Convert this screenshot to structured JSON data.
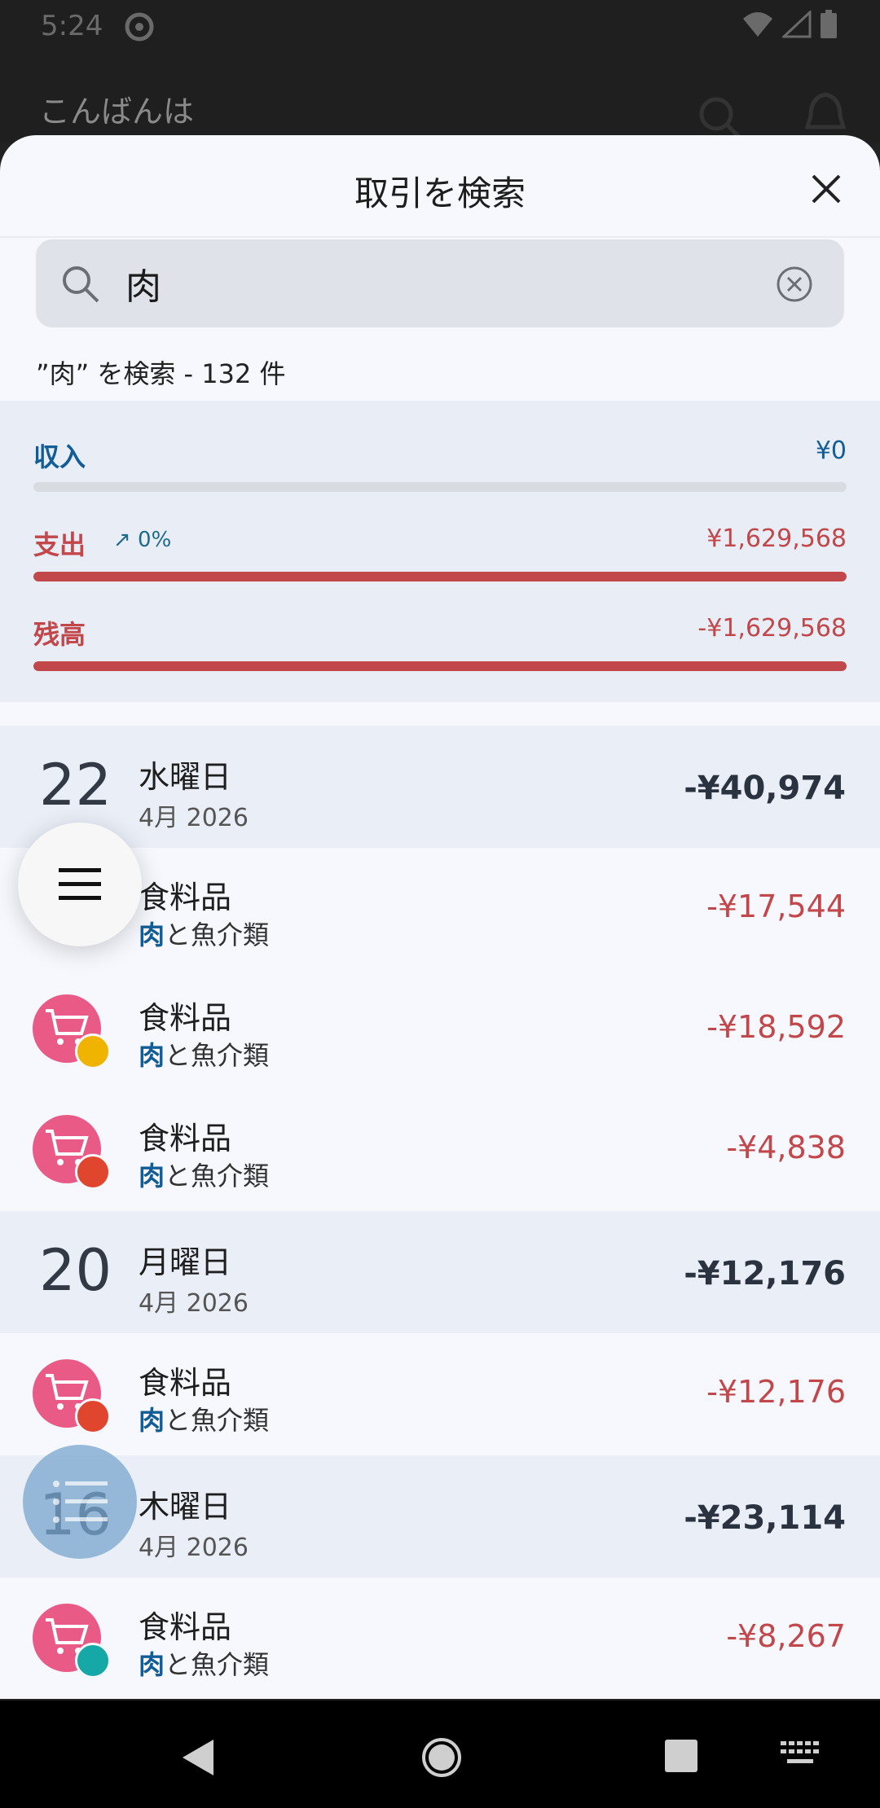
{
  "status_bar": {
    "time": "5:24"
  },
  "background_app": {
    "greeting": "こんばんは"
  },
  "sheet": {
    "title": "取引を検索"
  },
  "search": {
    "value": "肉",
    "result_text": "”肉” を検索 - 132 件"
  },
  "summary": {
    "income": {
      "label": "収入",
      "value": "¥0",
      "fill_fraction": 0,
      "color": "#135d96"
    },
    "expense": {
      "label": "支出",
      "trend": "↗ 0%",
      "value": "¥1,629,568",
      "fill_fraction": 1,
      "color": "#c2474a"
    },
    "balance": {
      "label": "残高",
      "value": "-¥1,629,568",
      "fill_fraction": 1,
      "color": "#c2474a"
    }
  },
  "days": [
    {
      "day": "22",
      "weekday": "水曜日",
      "month": "4月 2026",
      "total": "-¥40,974"
    },
    {
      "day": "20",
      "weekday": "月曜日",
      "month": "4月 2026",
      "total": "-¥12,176"
    },
    {
      "day": "16",
      "weekday": "木曜日",
      "month": "4月 2026",
      "total": "-¥23,114"
    }
  ],
  "transactions": [
    {
      "category": "食料品",
      "sub_highlight": "肉",
      "sub_rest": "と魚介類",
      "amount": "-¥17,544",
      "badge_color": "#f0b400",
      "badge": "cash"
    },
    {
      "category": "食料品",
      "sub_highlight": "肉",
      "sub_rest": "と魚介類",
      "amount": "-¥18,592",
      "badge_color": "#f0b400",
      "badge": "cash"
    },
    {
      "category": "食料品",
      "sub_highlight": "肉",
      "sub_rest": "と魚介類",
      "amount": "-¥4,838",
      "badge_color": "#e0452d",
      "badge": "wallet"
    },
    {
      "category": "食料品",
      "sub_highlight": "肉",
      "sub_rest": "と魚介類",
      "amount": "-¥12,176",
      "badge_color": "#e0452d",
      "badge": "wallet"
    },
    {
      "category": "食料品",
      "sub_highlight": "肉",
      "sub_rest": "と魚介類",
      "amount": "-¥8,267",
      "badge_color": "#15a8a6",
      "badge": "card"
    }
  ],
  "colors": {
    "accent_blue": "#135d96",
    "expense_red": "#c2474a",
    "category_pink": "#ea5a86"
  }
}
